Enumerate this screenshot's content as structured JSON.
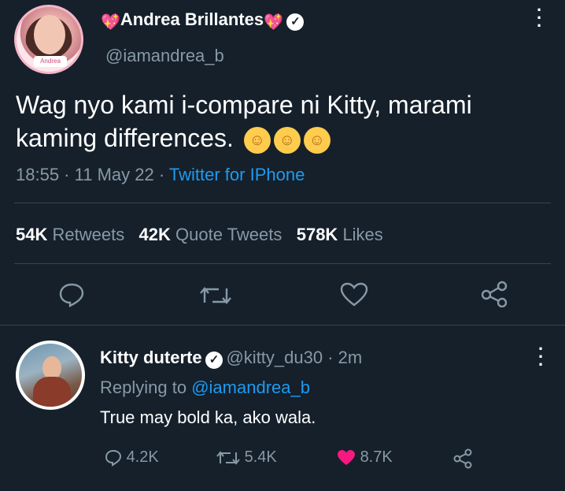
{
  "main_tweet": {
    "author_name": "Andrea Brillantes",
    "author_handle": "@iamandrea_b",
    "avatar_tag": "Andrea",
    "text": "Wag nyo kami i-compare ni Kitty, marami kaming differences.",
    "emojis": [
      "☺",
      "☺",
      "☺"
    ],
    "time": "18:55",
    "date": "11 May 22",
    "source": "Twitter for IPhone",
    "stats": {
      "retweets_count": "54K",
      "retweets_label": "Retweets",
      "quotes_count": "42K",
      "quotes_label": "Quote Tweets",
      "likes_count": "578K",
      "likes_label": "Likes"
    },
    "actions": [
      "reply-icon",
      "retweet-icon",
      "like-icon",
      "share-icon"
    ]
  },
  "reply_tweet": {
    "author_name": "Kitty duterte",
    "author_handle": "@kitty_du30",
    "age": "2m",
    "replying_prefix": "Replying to",
    "replying_to": "@iamandrea_b",
    "text": "True may bold ka, ako wala.",
    "counts": {
      "replies": "4.2K",
      "retweets": "5.4K",
      "likes": "8.7K"
    }
  },
  "colors": {
    "background": "#15202b",
    "link": "#1d9bf0",
    "muted": "#8899a6",
    "like_active": "#f91880"
  }
}
